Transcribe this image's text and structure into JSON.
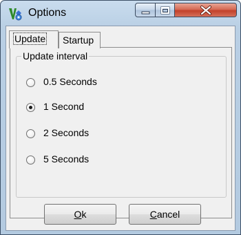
{
  "window": {
    "title": "Options",
    "icon": "options-app-icon"
  },
  "titlebar_buttons": {
    "minimize_icon": "minimize-icon",
    "maximize_icon": "maximize-icon",
    "close_icon": "close-icon"
  },
  "tabs": [
    {
      "label": "Update",
      "selected": true
    },
    {
      "label": "Startup",
      "selected": false
    }
  ],
  "update_interval": {
    "group_title": "Update interval",
    "options": [
      {
        "label": "0.5 Seconds",
        "checked": false
      },
      {
        "label": "1 Second",
        "checked": true
      },
      {
        "label": "2 Seconds",
        "checked": false
      },
      {
        "label": "5 Seconds",
        "checked": false
      }
    ]
  },
  "buttons": {
    "ok_mnemonic": "O",
    "ok_rest": "k",
    "cancel_mnemonic": "C",
    "cancel_rest": "ancel"
  },
  "colors": {
    "title_bar": "#b9cfe4",
    "close_button": "#c2412a",
    "dialog_face": "#f0f0f0"
  }
}
